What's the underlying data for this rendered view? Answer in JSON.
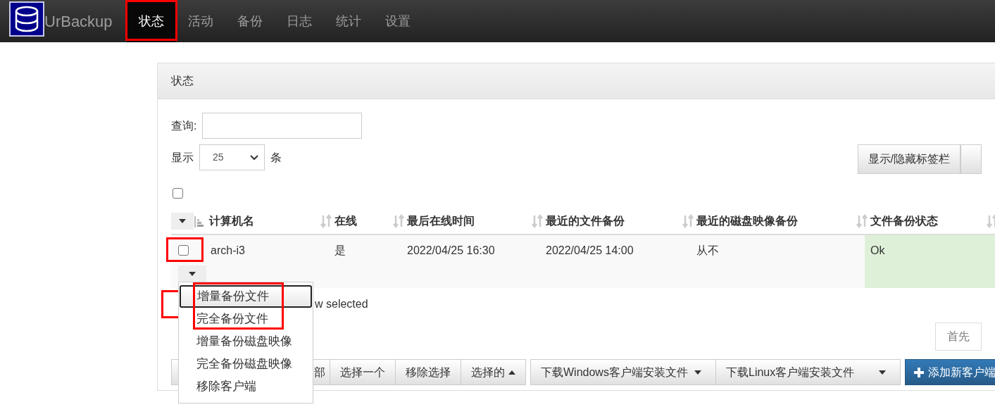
{
  "app": {
    "name": "UrBackup"
  },
  "nav": [
    {
      "label": "状态",
      "selected": true,
      "highlighted": true
    },
    {
      "label": "活动",
      "selected": false,
      "highlighted": false
    },
    {
      "label": "备份",
      "selected": false,
      "highlighted": false
    },
    {
      "label": "日志",
      "selected": false,
      "highlighted": false
    },
    {
      "label": "统计",
      "selected": false,
      "highlighted": false
    },
    {
      "label": "设置",
      "selected": false,
      "highlighted": false
    }
  ],
  "panel": {
    "title": "状态"
  },
  "search": {
    "label": "查询:"
  },
  "length": {
    "label": "显示",
    "value": "25",
    "suffix": "条"
  },
  "column_toggle": {
    "label": "显示/隐藏标签栏"
  },
  "table": {
    "select_all_checked": false,
    "control_sorted": true,
    "columns": [
      {
        "label": "计算机名",
        "sorted": false
      },
      {
        "label": "在线",
        "sorted": false
      },
      {
        "label": "最后在线时间",
        "sorted": false
      },
      {
        "label": "最近的文件备份",
        "sorted": false
      },
      {
        "label": "最近的磁盘映像备份",
        "sorted": false
      },
      {
        "label": "文件备份状态",
        "sorted": false
      }
    ],
    "rows": [
      {
        "checked": false,
        "highlighted": true,
        "color": "#dff0d8",
        "cells": [
          "arch-i3",
          "是",
          "2022/04/25 16:30",
          "2022/04/25 14:00",
          "从不",
          "Ok"
        ]
      }
    ]
  },
  "info": {
    "end": "w selected",
    "highlighted": true
  },
  "pagination": {
    "buttons": [
      "首先"
    ]
  },
  "menu": {
    "items": [
      {
        "label": "增量备份文件",
        "focused": true,
        "highlighted": true
      },
      {
        "label": "完全备份文件",
        "focused": false,
        "highlighted": true
      },
      {
        "label": "增量备份磁盘映像",
        "focused": false,
        "highlighted": false
      },
      {
        "label": "完全备份磁盘映像",
        "focused": false,
        "highlighted": false
      },
      {
        "label": "移除客户端",
        "focused": false,
        "highlighted": false
      }
    ]
  },
  "actions": [
    {
      "label": "部",
      "kind": "plain"
    },
    {
      "label": "选择一个",
      "kind": "plain"
    },
    {
      "label": "移除选择",
      "kind": "plain"
    },
    {
      "label": "选择的",
      "kind": "dropup"
    }
  ],
  "downloads": [
    {
      "label": "下载Windows客户端安装文件"
    },
    {
      "label": "下载Linux客户端安装文件"
    }
  ],
  "add_button": {
    "label": "添加新客户端"
  }
}
